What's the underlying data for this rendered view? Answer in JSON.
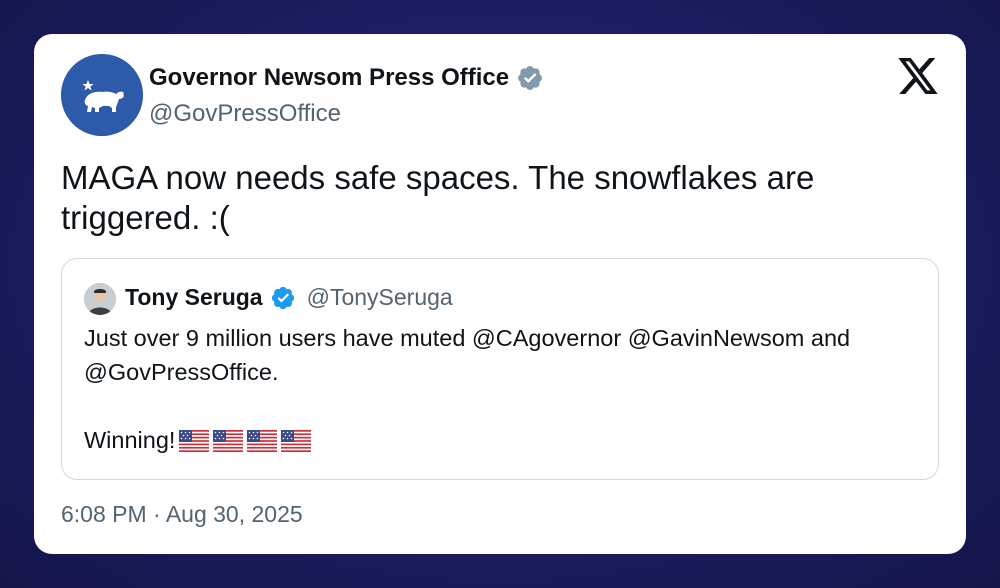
{
  "post": {
    "author_name": "Governor Newsom Press Office",
    "author_handle": "@GovPressOffice",
    "verified_badge": "gray-verified-badge",
    "text": "MAGA now needs safe spaces. The snowflakes are triggered. :(",
    "timestamp": "6:08 PM · Aug 30, 2025"
  },
  "quoted_post": {
    "author_name": "Tony Seruga",
    "author_handle": "@TonySeruga",
    "verified_badge": "blue-verified-badge",
    "text": "Just over 9 million users have muted @CAgovernor @GavinNewsom and @GovPressOffice.\n\nWinning!",
    "emoji": [
      "us-flag",
      "us-flag",
      "us-flag",
      "us-flag"
    ]
  },
  "colors": {
    "background": "#1f1f66",
    "card": "#ffffff",
    "avatar_blue": "#2d5aa9",
    "verified_gray": "#829aab",
    "verified_blue": "#1d9bf0",
    "secondary_text": "#536471"
  },
  "icons": {
    "platform_logo": "x-logo-icon"
  }
}
